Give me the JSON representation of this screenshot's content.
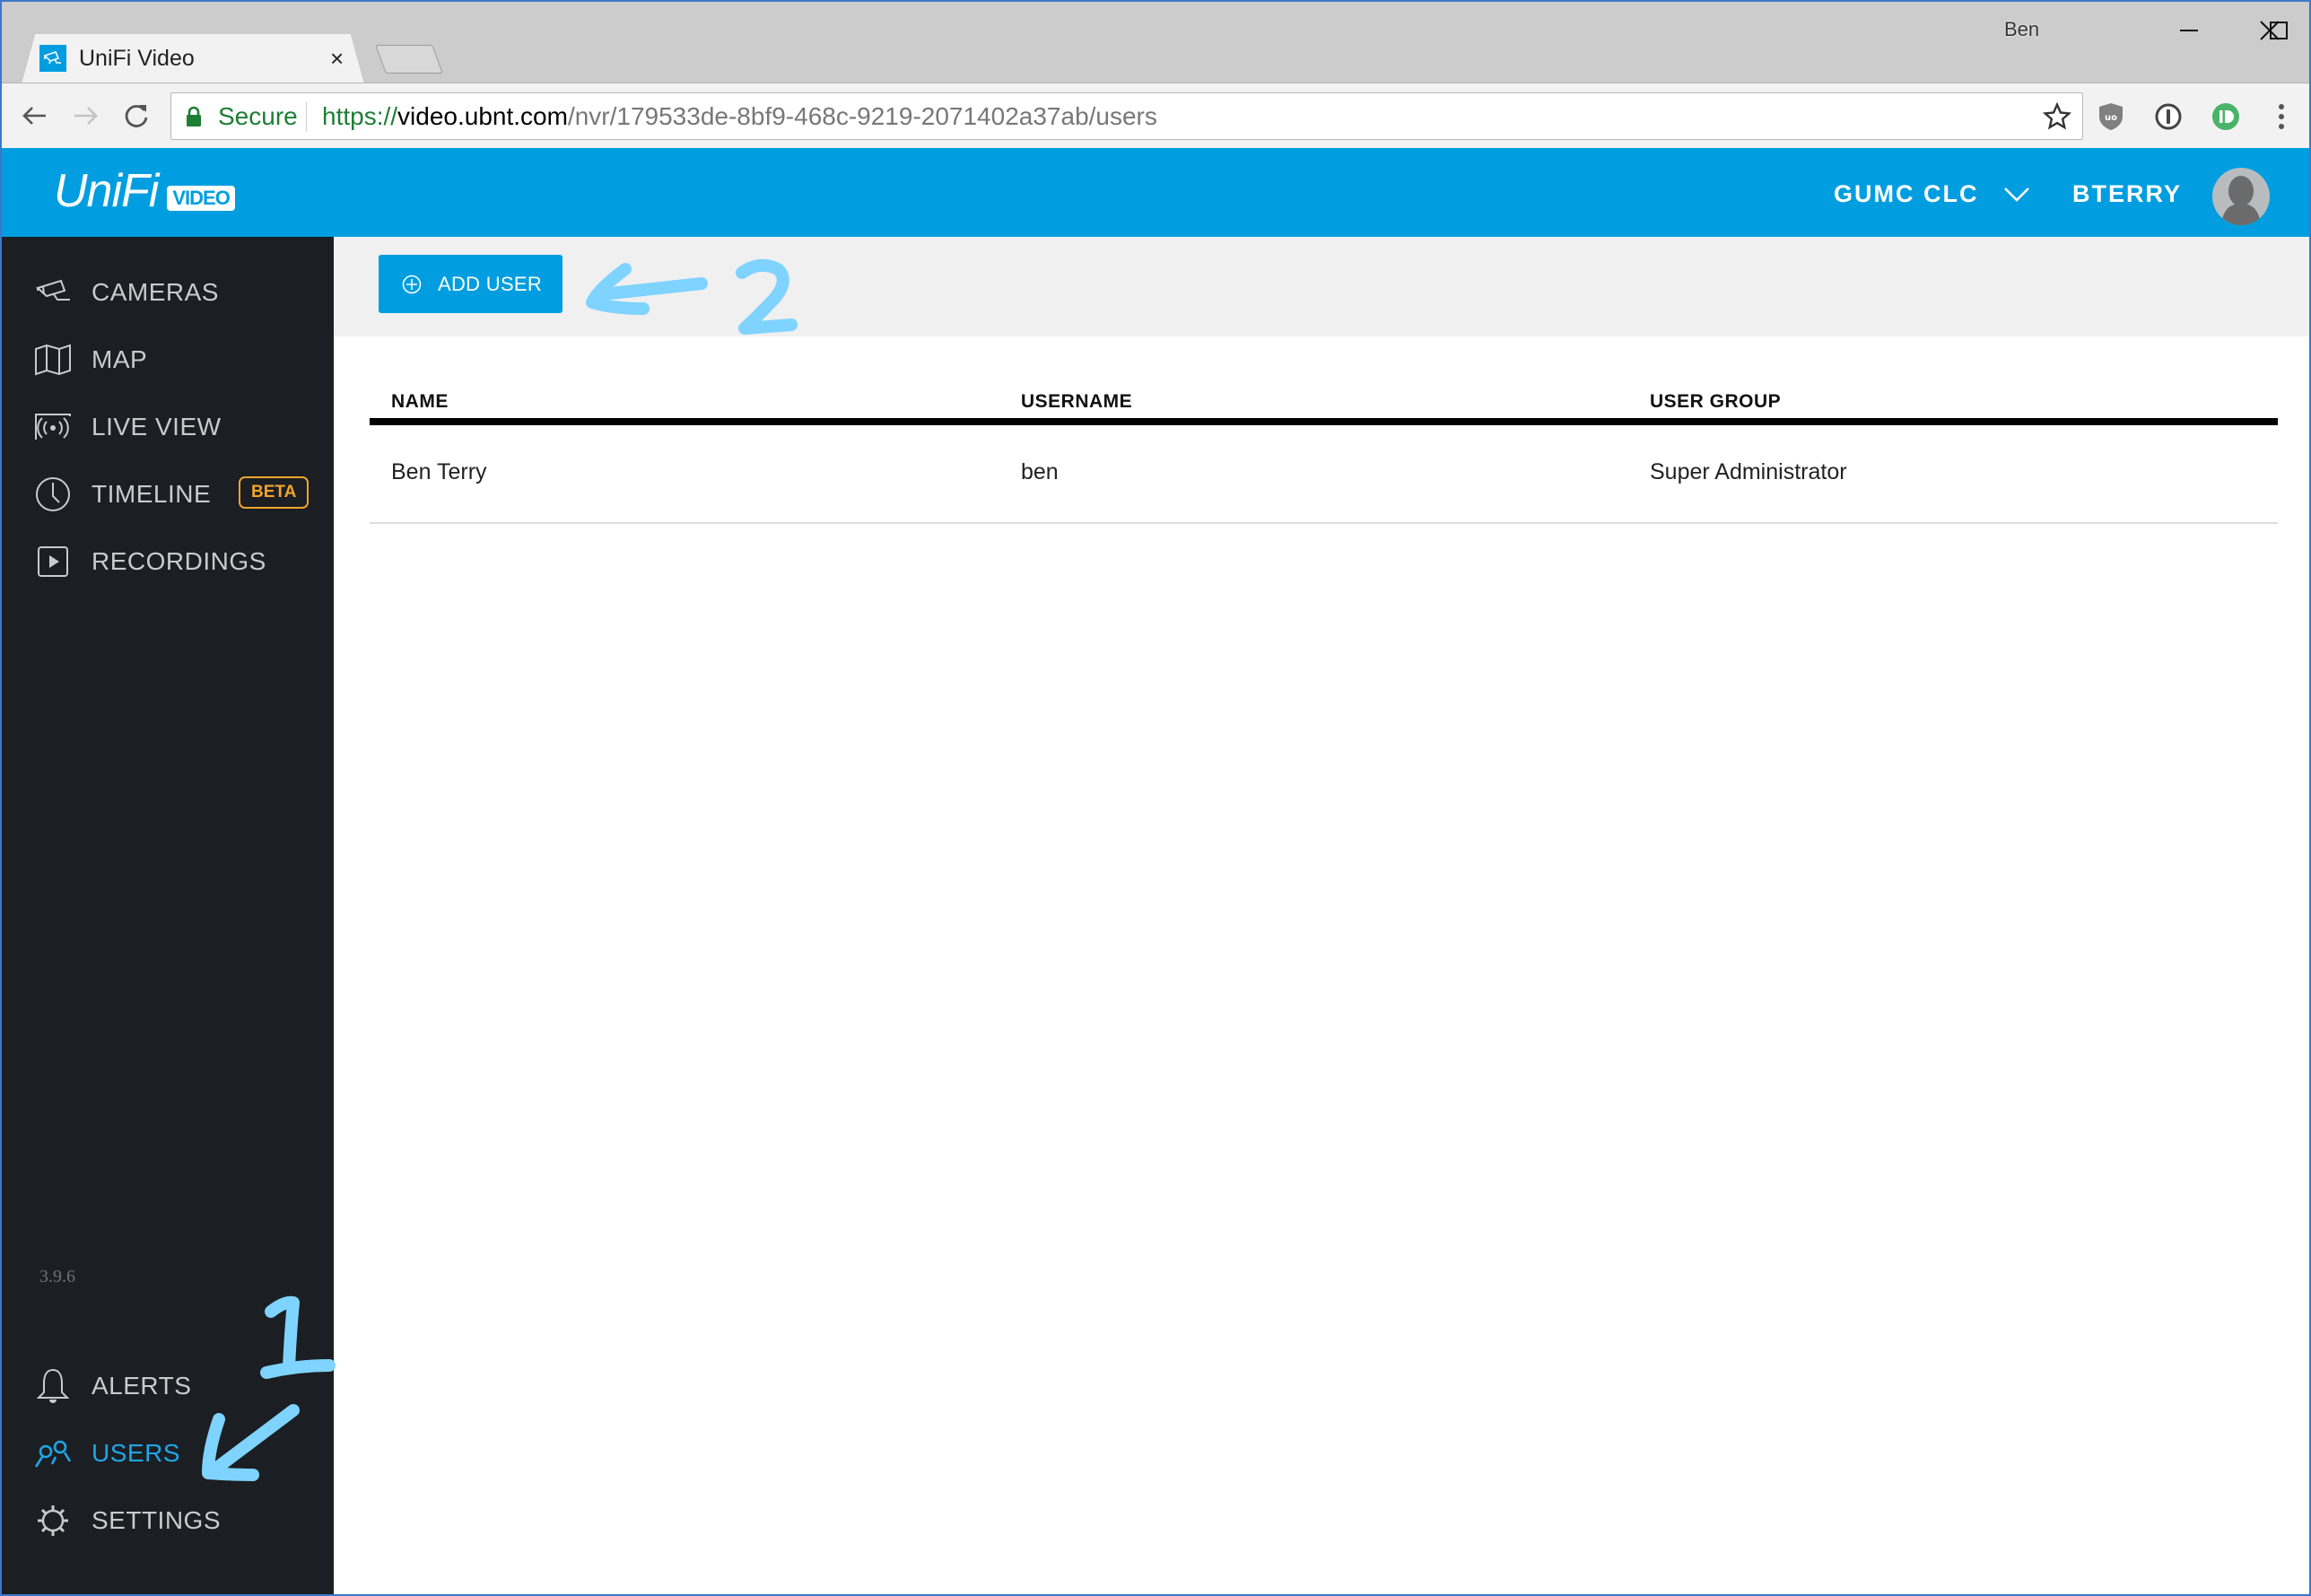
{
  "browser": {
    "tab_title": "UniFi Video",
    "tab_close": "×",
    "profile_name": "Ben",
    "secure_label": "Secure",
    "url_scheme": "https://",
    "url_host": "video.ubnt.com",
    "url_path": "/nvr/179533de-8bf9-468c-9219-2071402a37ab/users",
    "extensions": [
      "ublock-origin-icon",
      "onepassword-icon",
      "pushbullet-icon"
    ]
  },
  "header": {
    "logo_text": "UniFi",
    "logo_badge": "VIDEO",
    "site_name": "GUMC CLC",
    "user_name": "BTERRY"
  },
  "sidebar": {
    "items": [
      {
        "label": "CAMERAS",
        "icon": "camera-icon"
      },
      {
        "label": "MAP",
        "icon": "map-icon"
      },
      {
        "label": "LIVE VIEW",
        "icon": "live-view-icon"
      },
      {
        "label": "TIMELINE",
        "icon": "clock-icon",
        "badge": "BETA"
      },
      {
        "label": "RECORDINGS",
        "icon": "play-icon"
      }
    ],
    "version": "3.9.6",
    "bottom_items": [
      {
        "label": "ALERTS",
        "icon": "bell-icon"
      },
      {
        "label": "USERS",
        "icon": "users-icon",
        "active": true
      },
      {
        "label": "SETTINGS",
        "icon": "gear-icon"
      }
    ]
  },
  "content": {
    "add_user_label": "ADD USER",
    "table": {
      "columns": [
        "NAME",
        "USERNAME",
        "USER GROUP"
      ],
      "rows": [
        {
          "name": "Ben Terry",
          "username": "ben",
          "user_group": "Super Administrator"
        }
      ]
    }
  },
  "annotations": {
    "step1": "1",
    "step2": "2"
  },
  "colors": {
    "brand": "#009ee0",
    "sidebar_bg": "#1b1e22",
    "active": "#1ea6e8",
    "beta": "#f0a52c",
    "annotation": "#7fd3ff"
  }
}
